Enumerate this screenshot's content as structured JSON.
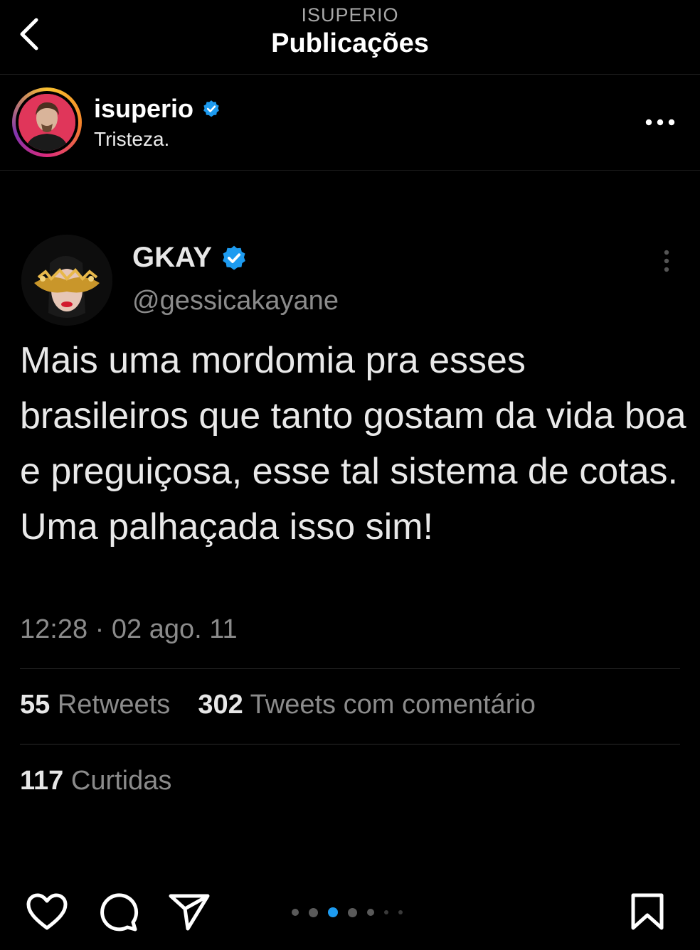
{
  "header": {
    "subtitle": "ISUPERIO",
    "title": "Publicações"
  },
  "post": {
    "username": "isuperio",
    "verified": true,
    "caption": "Tristeza.",
    "ring_colors": [
      "#f9c12e",
      "#f58529",
      "#dd2a7b",
      "#8134af"
    ]
  },
  "tweet": {
    "display_name": "GKAY",
    "handle": "@gessicakayane",
    "text": "Mais uma mordomia pra esses brasileiros que tanto gostam da vida boa e preguiçosa, esse tal sistema de cotas. Uma palhaçada isso sim!",
    "timestamp": "12:28 · 02 ago. 11",
    "retweets_count": "55",
    "retweets_label": "Retweets",
    "quotes_count": "302",
    "quotes_label": "Tweets com comentário",
    "likes_count": "117",
    "likes_label": "Curtidas"
  },
  "carousel": {
    "dot_count": 7,
    "active_index": 2
  },
  "colors": {
    "background": "#000000",
    "verified": "#1d9bf0",
    "dot_active": "#1d9bf0",
    "muted_text": "#8b8b8b"
  },
  "icons": [
    "back-arrow-icon",
    "verified-badge-icon",
    "more-options-icon",
    "heart-icon",
    "comment-icon",
    "share-icon",
    "bookmark-icon"
  ]
}
